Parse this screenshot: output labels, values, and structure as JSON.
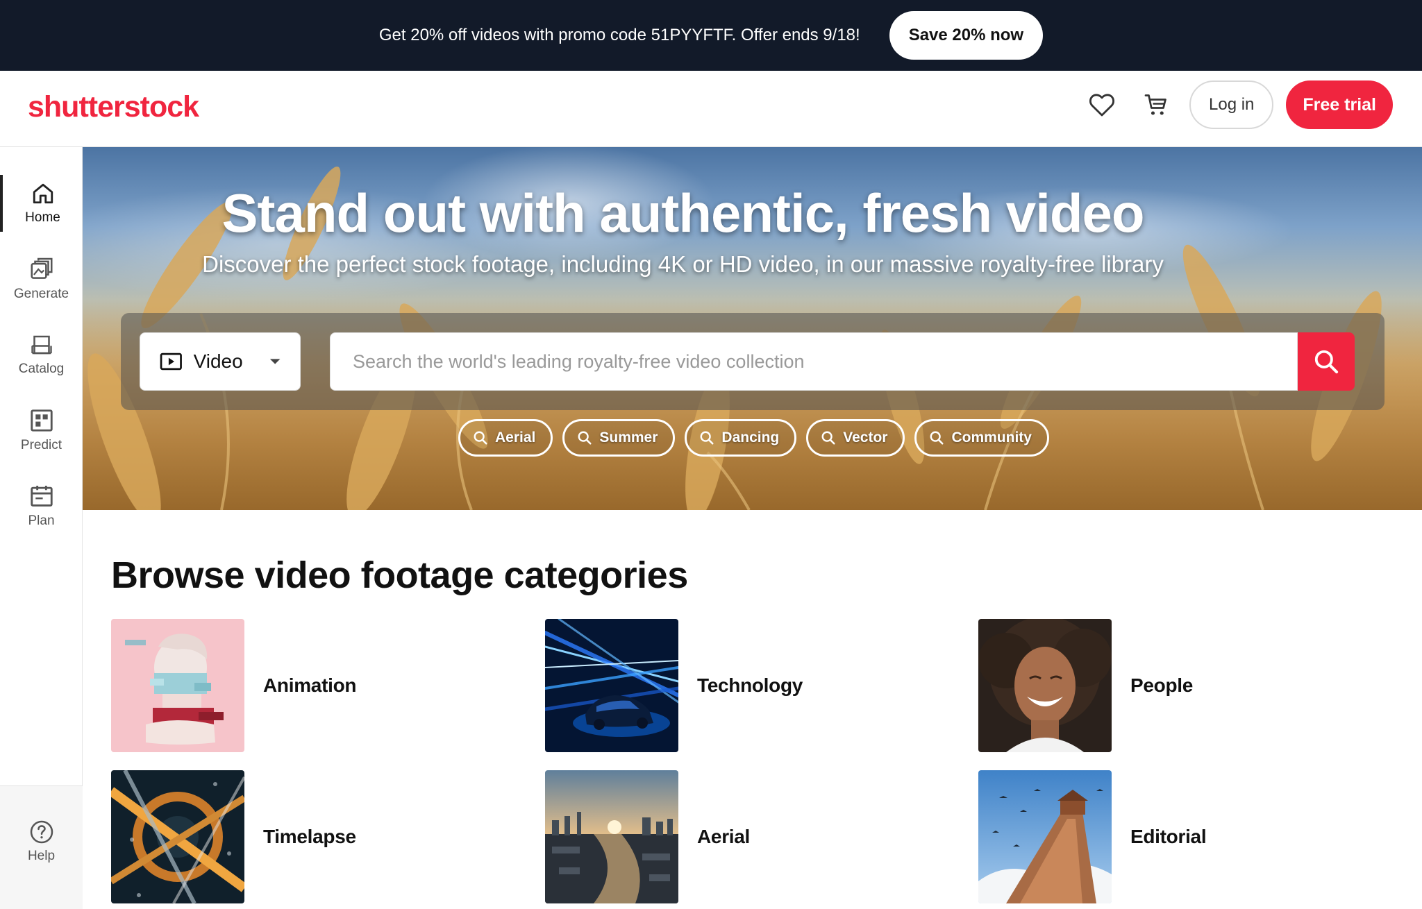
{
  "promo": {
    "text": "Get 20% off videos with promo code 51PYYFTF. Offer ends 9/18!",
    "button": "Save 20% now"
  },
  "header": {
    "logo": "shutterstock",
    "brand_color": "#f0253f",
    "favorites_icon": "heart-icon",
    "cart_icon": "cart-icon",
    "login": "Log in",
    "trial": "Free trial"
  },
  "sidebar": {
    "items": [
      {
        "label": "Home",
        "icon": "home-icon",
        "active": true
      },
      {
        "label": "Generate",
        "icon": "generate-icon"
      },
      {
        "label": "Catalog",
        "icon": "catalog-icon"
      },
      {
        "label": "Predict",
        "icon": "predict-icon"
      },
      {
        "label": "Plan",
        "icon": "plan-icon"
      }
    ],
    "help": {
      "label": "Help",
      "icon": "help-icon"
    }
  },
  "hero": {
    "title": "Stand out with authentic, fresh video",
    "subtitle": "Discover the perfect stock footage, including 4K or HD video, in our massive royalty-free library",
    "media_type": "Video",
    "search_placeholder": "Search the world's leading royalty-free video collection",
    "chips": [
      "Aerial",
      "Summer",
      "Dancing",
      "Vector",
      "Community"
    ]
  },
  "browse": {
    "title": "Browse video footage categories",
    "categories": [
      {
        "label": "Animation"
      },
      {
        "label": "Technology"
      },
      {
        "label": "People"
      },
      {
        "label": "Timelapse"
      },
      {
        "label": "Aerial"
      },
      {
        "label": "Editorial"
      }
    ]
  }
}
